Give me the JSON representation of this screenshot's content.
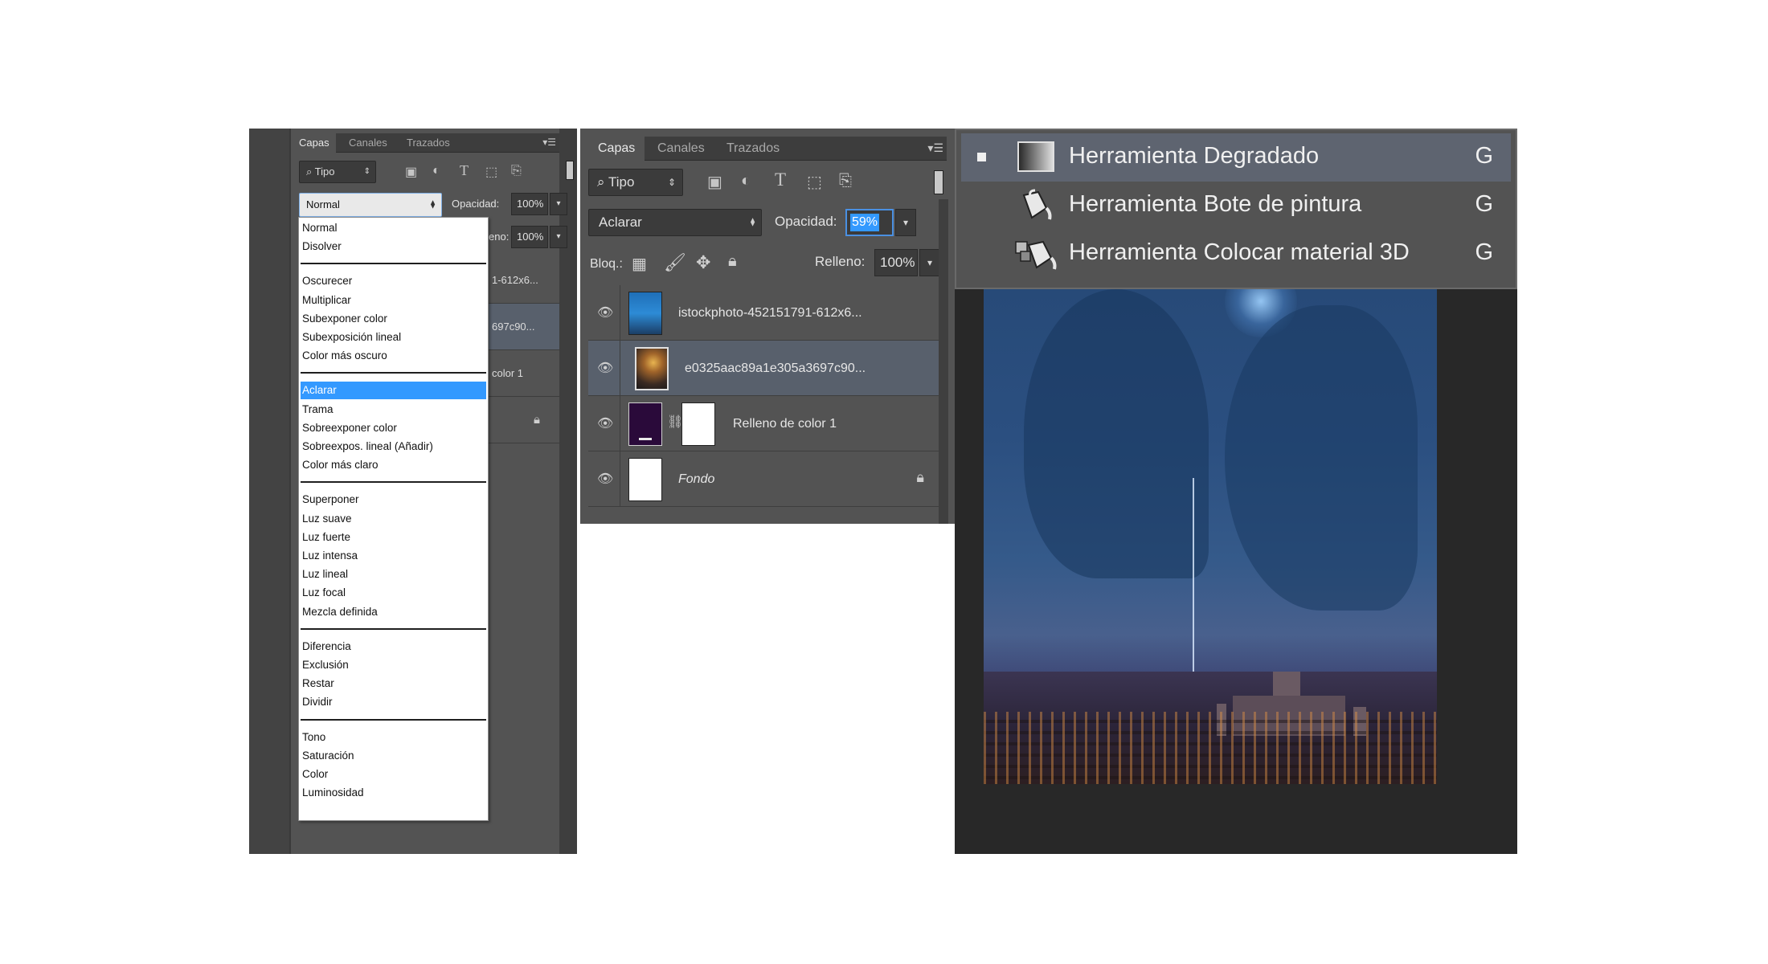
{
  "panel_a": {
    "tabs": [
      "Capas",
      "Canales",
      "Trazados"
    ],
    "filter_label": "Tipo",
    "blend_mode": "Normal",
    "opacity_label": "Opacidad:",
    "opacity_value": "100%",
    "fill_label_partial": "eno:",
    "fill_value": "100%",
    "layer_partials": [
      "1-612x6...",
      "697c90...",
      "color 1"
    ],
    "blend_menu": [
      {
        "label": "Normal"
      },
      {
        "label": "Disolver"
      },
      {
        "label": "Oscurecer"
      },
      {
        "label": "Multiplicar"
      },
      {
        "label": "Subexponer color"
      },
      {
        "label": "Subexposición lineal"
      },
      {
        "label": "Color más oscuro"
      },
      {
        "label": "Aclarar",
        "selected": true
      },
      {
        "label": "Trama"
      },
      {
        "label": "Sobreexponer color"
      },
      {
        "label": "Sobreexpos. lineal (Añadir)"
      },
      {
        "label": "Color más claro"
      },
      {
        "label": "Superponer"
      },
      {
        "label": "Luz suave"
      },
      {
        "label": "Luz fuerte"
      },
      {
        "label": "Luz intensa"
      },
      {
        "label": "Luz lineal"
      },
      {
        "label": "Luz focal"
      },
      {
        "label": "Mezcla definida"
      },
      {
        "label": "Diferencia"
      },
      {
        "label": "Exclusión"
      },
      {
        "label": "Restar"
      },
      {
        "label": "Dividir"
      },
      {
        "label": "Tono"
      },
      {
        "label": "Saturación"
      },
      {
        "label": "Color"
      },
      {
        "label": "Luminosidad"
      }
    ]
  },
  "panel_b": {
    "tabs": [
      "Capas",
      "Canales",
      "Trazados"
    ],
    "filter_label": "Tipo",
    "blend_mode": "Aclarar",
    "opacity_label": "Opacidad:",
    "opacity_value": "59%",
    "lock_label": "Bloq.:",
    "fill_label": "Relleno:",
    "fill_value": "100%",
    "layers": [
      {
        "name": "istockphoto-452151791-612x6..."
      },
      {
        "name": "e0325aac89a1e305a3697c90...",
        "selected": true
      },
      {
        "name": "Relleno de color 1"
      },
      {
        "name": "Fondo",
        "locked": true
      }
    ]
  },
  "tool_popup": {
    "tools": [
      {
        "name": "Herramienta Degradado",
        "shortcut": "G",
        "selected": true,
        "icon": "gradient-tool-icon"
      },
      {
        "name": "Herramienta Bote de pintura",
        "shortcut": "G",
        "icon": "paint-bucket-icon"
      },
      {
        "name": "Herramienta Colocar material 3D",
        "shortcut": "G",
        "icon": "3d-material-drop-icon"
      }
    ]
  },
  "colors": {
    "panel_bg": "#535353",
    "selection_blue": "#3399ff",
    "selected_layer": "#58606c",
    "fill_layer_color": "#2a0a3a"
  }
}
